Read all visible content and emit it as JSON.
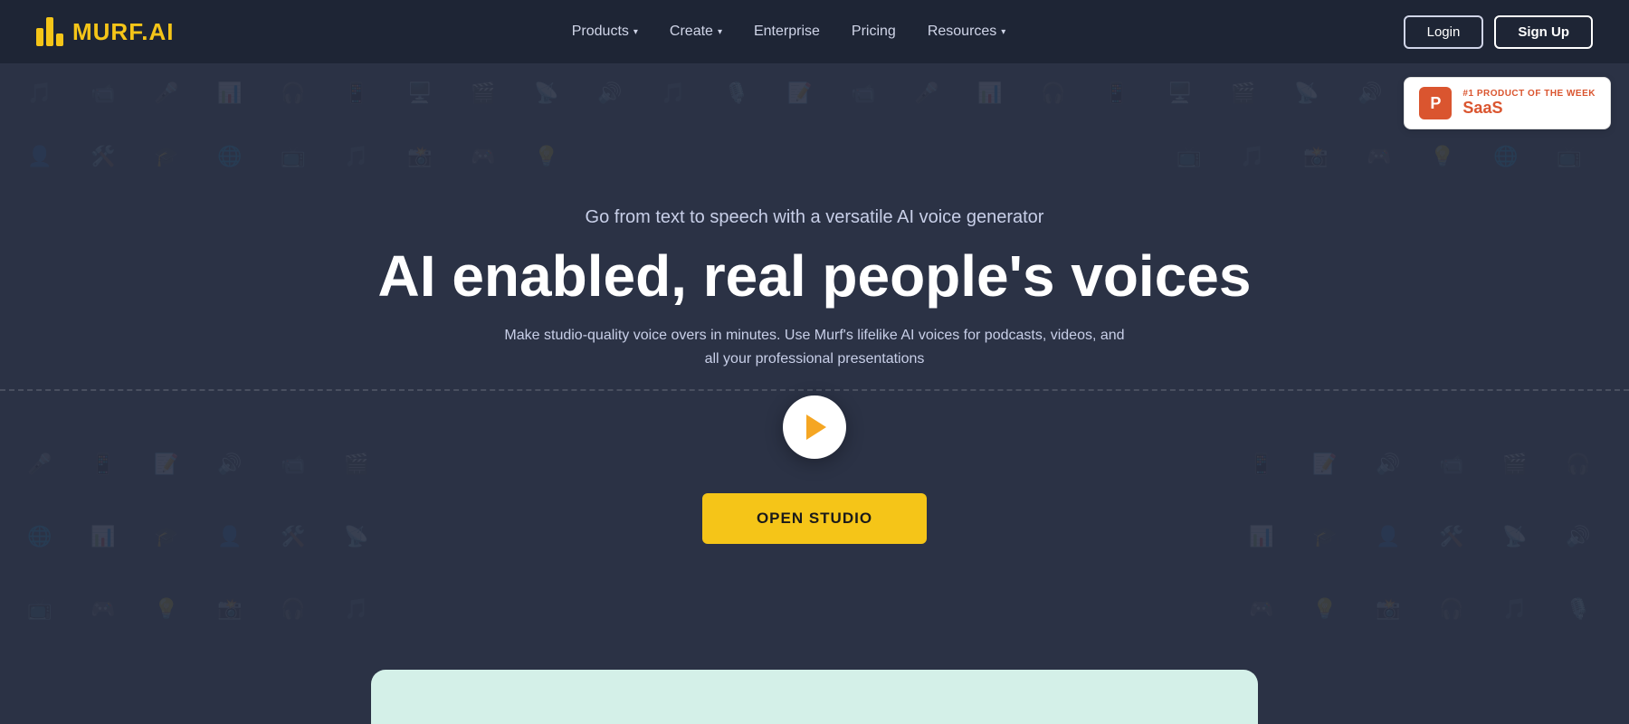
{
  "logo": {
    "text": "MURF",
    "suffix": ".AI"
  },
  "navbar": {
    "items": [
      {
        "label": "Products",
        "hasDropdown": true
      },
      {
        "label": "Create",
        "hasDropdown": true
      },
      {
        "label": "Enterprise",
        "hasDropdown": false
      },
      {
        "label": "Pricing",
        "hasDropdown": false
      },
      {
        "label": "Resources",
        "hasDropdown": true
      }
    ],
    "login_label": "Login",
    "signup_label": "Sign Up"
  },
  "hero": {
    "subtitle": "Go from text to speech with a versatile AI voice generator",
    "title": "AI enabled, real people's voices",
    "description": "Make studio-quality voice overs in minutes. Use Murf's lifelike AI voices for podcasts, videos, and all your professional presentations",
    "cta_label": "OPEN STUDIO"
  },
  "product_hunt": {
    "badge_label": "#1 PRODUCT OF THE WEEK",
    "category": "SaaS",
    "logo_letter": "P"
  }
}
